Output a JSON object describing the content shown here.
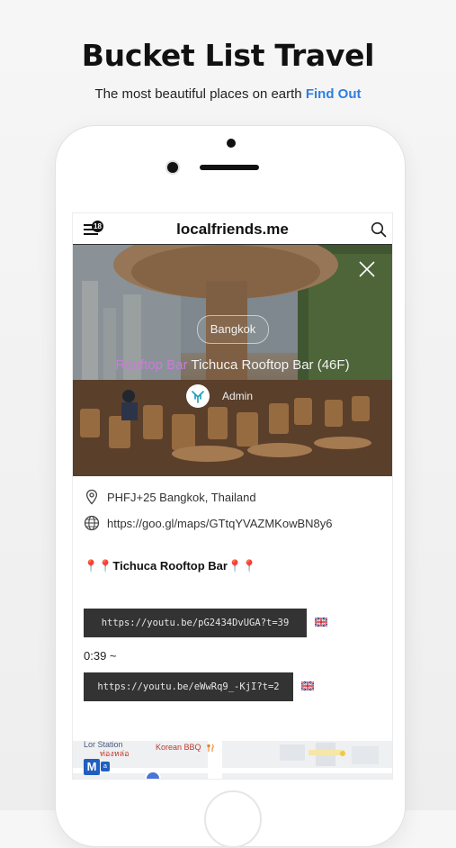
{
  "promo": {
    "title": "Bucket List Travel",
    "subtitle": "The most beautiful places on earth",
    "link": "Find Out"
  },
  "appbar": {
    "site_title": "localfriends.me",
    "menu_badge": "18",
    "menu_icon": "hamburger-menu-icon",
    "search_icon": "search-icon"
  },
  "hero": {
    "city": "Bangkok",
    "category": "Rooftop Bar",
    "title": "Tichuca Rooftop Bar (46F)",
    "author": "Admin",
    "close_icon": "close-icon"
  },
  "details": {
    "address": "PHFJ+25 Bangkok, Thailand",
    "map_url": "https://goo.gl/maps/GTtqYVAZMKowBN8y6",
    "place_heading": "📍📍Tichuca Rooftop Bar📍📍",
    "video_1": "https://youtu.be/pG2434DvUGA?t=39",
    "timestamp": "0:39 ~",
    "video_2": "https://youtu.be/eWwRq9_-KjI?t=2"
  },
  "map": {
    "label_station": "Lor Station",
    "label_thai": "ท่องหล่อ",
    "label_restaurant": "Korean BBQ",
    "metro_label": "M",
    "metro_small": "a"
  },
  "colors": {
    "link": "#2f7de1",
    "category": "#c77dd6",
    "video_button": "#333333",
    "metro": "#1f5fbf"
  }
}
